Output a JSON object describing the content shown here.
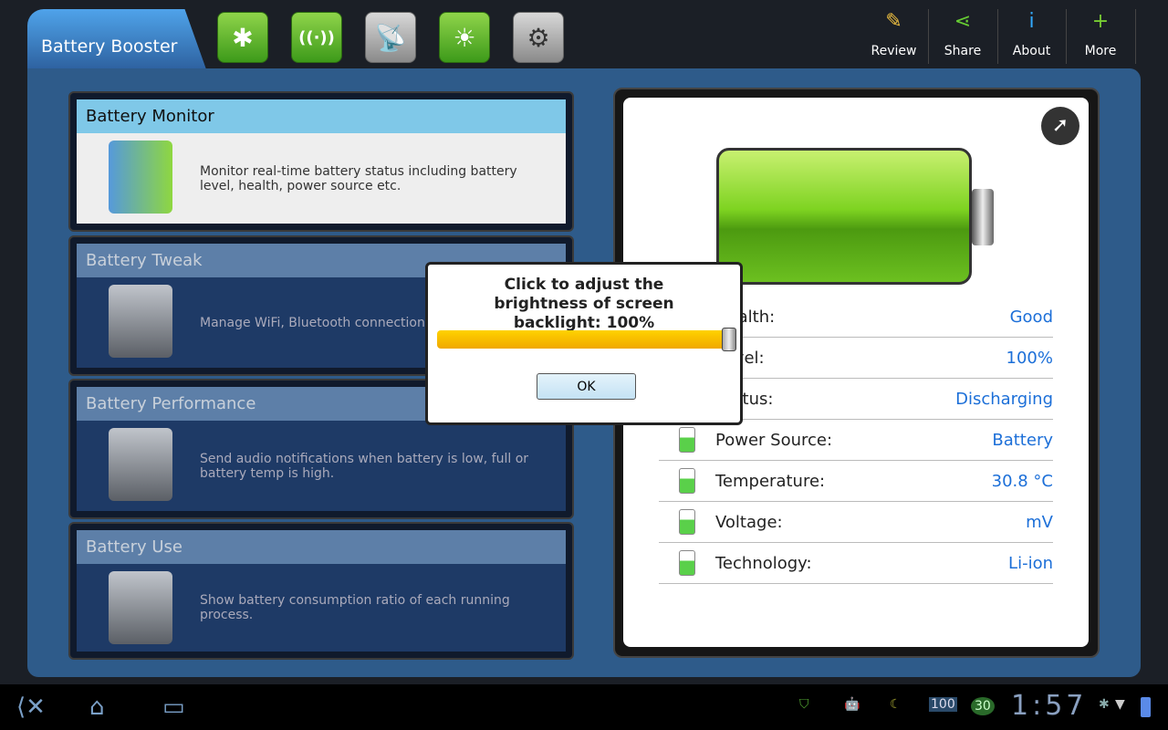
{
  "app": {
    "title": "Battery Booster"
  },
  "quick_toggles": [
    {
      "icon": "bluetooth-icon",
      "glyph": "✱",
      "state": "on"
    },
    {
      "icon": "wifi-icon",
      "glyph": "((·))",
      "state": "on"
    },
    {
      "icon": "gps-satellite-icon",
      "glyph": "📡",
      "state": "off"
    },
    {
      "icon": "brightness-icon",
      "glyph": "☀",
      "state": "on"
    },
    {
      "icon": "auto-sync-timer-icon",
      "glyph": "⚙",
      "state": "off"
    }
  ],
  "actions": [
    {
      "label": "Review",
      "icon": "pencil-icon",
      "glyph": "✎",
      "color": "#f0c040"
    },
    {
      "label": "Share",
      "icon": "share-icon",
      "glyph": "⋖",
      "color": "#6c3"
    },
    {
      "label": "About",
      "icon": "info-icon",
      "glyph": "i",
      "color": "#3af"
    },
    {
      "label": "More",
      "icon": "plus-icon",
      "glyph": "+",
      "color": "#7c3"
    }
  ],
  "cards": [
    {
      "title": "Battery Monitor",
      "desc": "Monitor real-time battery status including battery level, health, power source etc.",
      "selected": true
    },
    {
      "title": "Battery Tweak",
      "desc": "Manage WiFi, Bluetooth connection and"
    },
    {
      "title": "Battery Performance",
      "desc": "Send audio notifications when battery is low, full or battery temp is high."
    },
    {
      "title": "Battery Use",
      "desc": "Show battery consumption ratio of each running process."
    }
  ],
  "battery": {
    "level_percent": 100,
    "rows": [
      {
        "label": "Health:",
        "value": "Good"
      },
      {
        "label": "Level:",
        "value": "100%"
      },
      {
        "label": "Status:",
        "value": "Discharging"
      },
      {
        "label": "Power Source:",
        "value": "Battery"
      },
      {
        "label": "Temperature:",
        "value": "30.8 °C"
      },
      {
        "label": "Voltage:",
        "value": "mV"
      },
      {
        "label": "Technology:",
        "value": "Li-ion"
      }
    ]
  },
  "dialog": {
    "text": "Click to adjust the brightness of screen backlight: 100%",
    "brightness_percent": 100,
    "ok": "OK"
  },
  "statusbar": {
    "time": "1:57",
    "battery_badge": "100",
    "timer_badge": "30"
  }
}
